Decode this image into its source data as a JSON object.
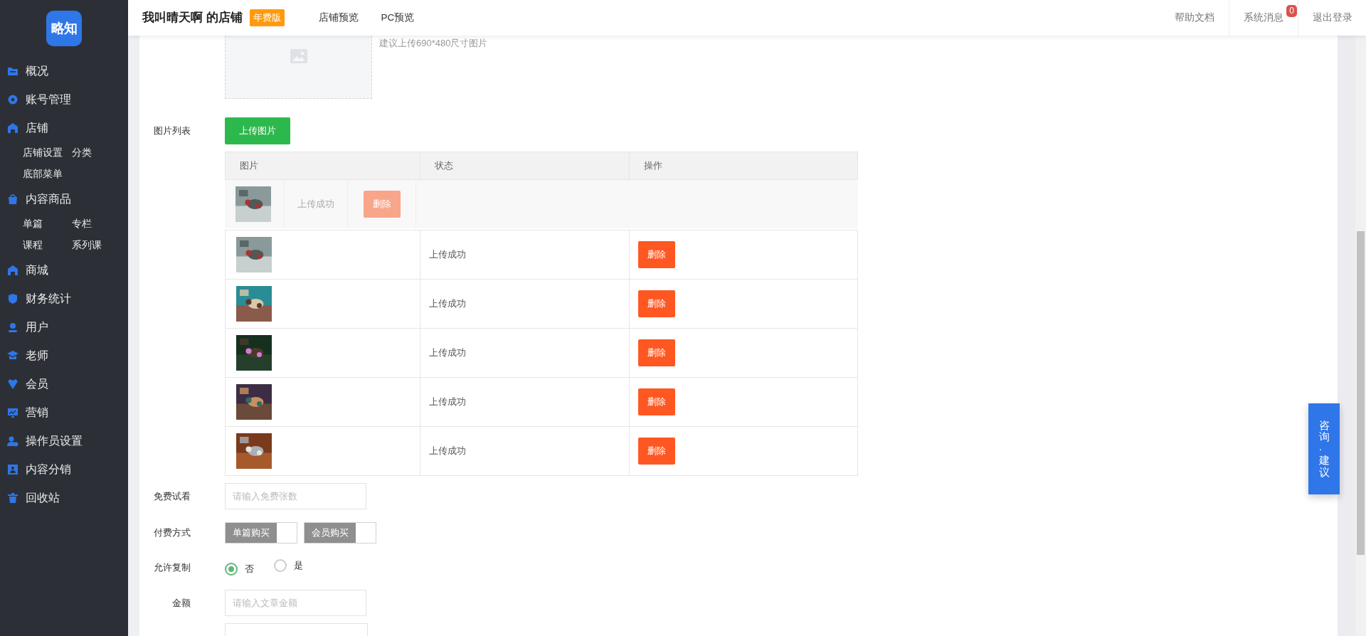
{
  "sidebar": {
    "logo": "略知",
    "items": [
      {
        "label": "概况"
      },
      {
        "label": "账号管理"
      },
      {
        "label": "店铺",
        "children": [
          {
            "label": "店铺设置"
          },
          {
            "label": "分类"
          },
          {
            "label": "底部菜单"
          }
        ]
      },
      {
        "label": "内容商品",
        "children": [
          {
            "label": "单篇"
          },
          {
            "label": "专栏"
          },
          {
            "label": "课程"
          },
          {
            "label": "系列课"
          }
        ]
      },
      {
        "label": "商城"
      },
      {
        "label": "财务统计"
      },
      {
        "label": "用户"
      },
      {
        "label": "老师"
      },
      {
        "label": "会员"
      },
      {
        "label": "营销"
      },
      {
        "label": "操作员设置"
      },
      {
        "label": "内容分销"
      },
      {
        "label": "回收站"
      }
    ]
  },
  "header": {
    "shop_title": "我叫晴天啊 的店铺",
    "plan_badge": "年费版",
    "nav": [
      "店铺预览",
      "PC预览"
    ],
    "links": [
      {
        "label": "帮助文档"
      },
      {
        "label": "系统消息",
        "badge": "0"
      },
      {
        "label": "退出登录"
      }
    ]
  },
  "form": {
    "upload": {
      "hint": "建议上传690*480尺寸图片"
    },
    "image_list": {
      "label": "图片列表",
      "upload_button": "上传图片",
      "columns": [
        "图片",
        "状态",
        "操作"
      ],
      "rows": [
        {
          "status": "上传成功",
          "action": "删除"
        },
        {
          "status": "上传成功",
          "action": "删除"
        },
        {
          "status": "上传成功",
          "action": "删除"
        },
        {
          "status": "上传成功",
          "action": "删除"
        },
        {
          "status": "上传成功",
          "action": "删除"
        }
      ],
      "dragging_row": {
        "status": "上传成功",
        "action": "删除"
      }
    },
    "free_preview": {
      "label": "免费试看",
      "placeholder": "请输入免费张数"
    },
    "payment": {
      "label": "付费方式",
      "options": [
        {
          "label": "单篇购买",
          "checked": false
        },
        {
          "label": "会员购买",
          "checked": false
        }
      ]
    },
    "allow_copy": {
      "label": "允许复制",
      "options": [
        {
          "label": "否",
          "selected": true
        },
        {
          "label": "是",
          "selected": false
        }
      ]
    },
    "amount": {
      "label": "金额",
      "placeholder": "请输入文章金额"
    }
  },
  "feedback_button": "咨询·建议"
}
